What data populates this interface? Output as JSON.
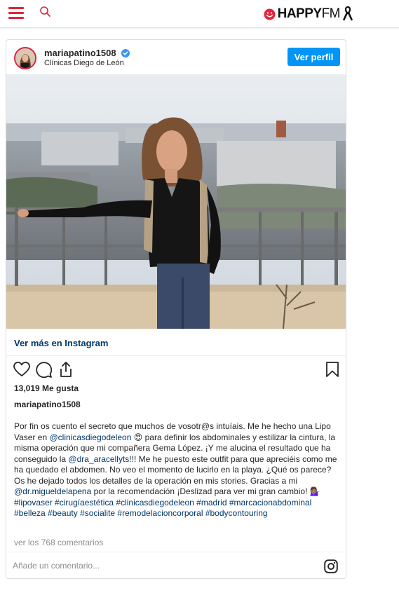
{
  "site": {
    "brand_happy": "HAPPY",
    "brand_fm": "FM"
  },
  "post": {
    "username": "mariapatino1508",
    "location": "Clínicas Diego de León",
    "view_profile": "Ver perfil",
    "view_more": "Ver más en Instagram",
    "likes": "13,019 Me gusta",
    "caption_user": "mariapatino1508",
    "caption": {
      "p1": "Por fin os cuento el secreto que muchos de vosotr@s intuíais. Me he hecho una Lipo Vaser en ",
      "m1": "@clinicasdiegodeleon",
      "e1": " 😍 ",
      "p2": "para definir los abdominales y estilizar la cintura, la misma operación que mi compañera Gema López. ¡Y me alucina el resultado que ha conseguido la ",
      "m2": "@dra_aracellyts",
      "p3": "!!! Me he puesto este outfit para que apreciéis como me ha quedado el abdomen. No veo el momento de lucirlo en la playa. ¿Qué os parece? Os he dejado todos los detalles de la operación en mis stories. Gracias a mi ",
      "m3": "@dr.migueldelapena",
      "p4": " por la recomendación ¡Deslizad para ver mi gran cambio! ",
      "e2": "💁🏽‍♀️",
      "hashtags": "#lipovaser #cirugíaestética #clinicasdiegodeleon #madrid #marcacionabdominal #belleza #beauty #socialite #remodelacioncorporal #bodycontouring"
    },
    "comments_link": "ver los 768 comentarios",
    "comment_placeholder": "Añade un comentario..."
  },
  "colors": {
    "accent": "#e2253a",
    "link": "#00376b",
    "button": "#0095f6",
    "muted": "#8e8e8e"
  },
  "icons": [
    "menu-icon",
    "search-icon",
    "happy-face-icon",
    "ribbon-icon",
    "verified-icon",
    "heart-icon",
    "comment-icon",
    "share-icon",
    "bookmark-icon",
    "instagram-icon"
  ]
}
